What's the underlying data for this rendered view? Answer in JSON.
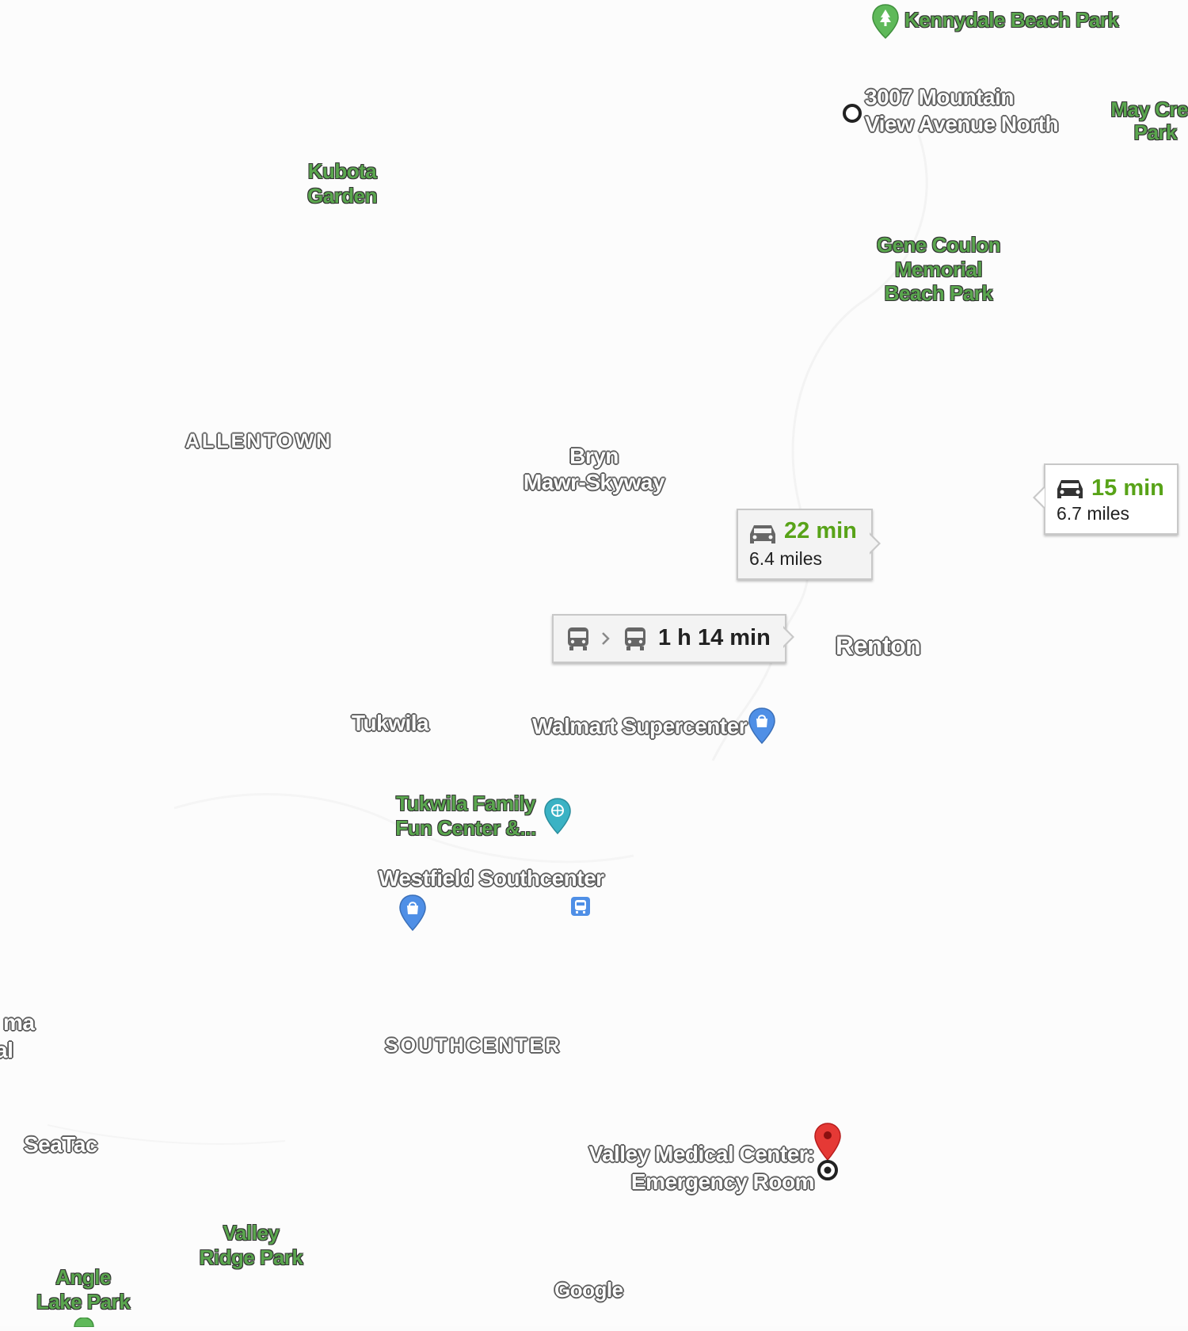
{
  "map": {
    "parks": [
      {
        "id": "kennydale",
        "label": "Kennydale Beach Park"
      },
      {
        "id": "may-creek",
        "line1": "May Cre",
        "line2": "Park"
      },
      {
        "id": "kubota",
        "line1": "Kubota",
        "line2": "Garden"
      },
      {
        "id": "gene-coulon",
        "line1": "Gene Coulon",
        "line2": "Memorial",
        "line3": "Beach Park"
      },
      {
        "id": "valley-ridge",
        "line1": "Valley",
        "line2": "Ridge Park"
      },
      {
        "id": "angle-lake",
        "line1": "Angle",
        "line2": "Lake Park"
      }
    ],
    "places": {
      "origin_line1": "3007 Mountain",
      "origin_line2": "View Avenue North",
      "bryn_line1": "Bryn",
      "bryn_line2": "Mawr-Skyway",
      "renton": "Renton",
      "tukwila": "Tukwila",
      "walmart": "Walmart Supercenter",
      "fun_center_line1": "Tukwila Family",
      "fun_center_line2": "Fun Center &...",
      "westfield": "Westfield Southcenter",
      "seatac": "SeaTac",
      "destination_line1": "Valley Medical Center:",
      "destination_line2": "Emergency Room",
      "partial_line1": "ma",
      "partial_line2": "al"
    },
    "neighborhoods": {
      "allentown": "ALLENTOWN",
      "southcenter": "SOUTHCENTER"
    },
    "attribution": "Google"
  },
  "routes": [
    {
      "mode": "car-icon",
      "time": "22 min",
      "distance": "6.4 miles",
      "selected": true
    },
    {
      "mode": "car-icon",
      "time": "15 min",
      "distance": "6.7 miles",
      "selected": false
    },
    {
      "mode": "bus-icon",
      "time": "1 h 14 min",
      "selected": false
    }
  ],
  "colors": {
    "park_text": "#5aa64e",
    "route_time": "#58a318",
    "destination_pin": "#e53935",
    "shopping_pin": "#4f8fe6",
    "recreation_pin": "#3ab2c4"
  }
}
